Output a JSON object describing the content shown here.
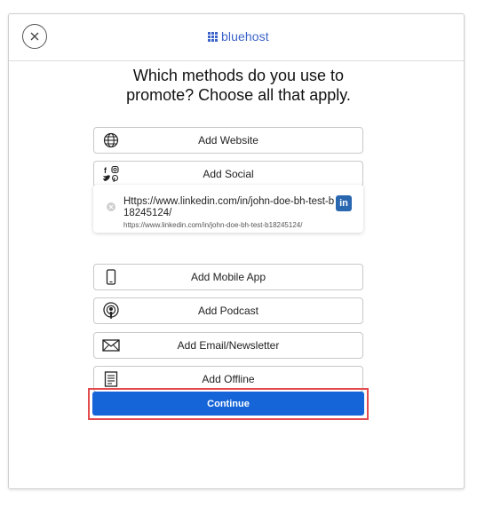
{
  "brand": {
    "logo_text": "bluehost",
    "color": "#3b63c9"
  },
  "title_line1": "Which methods do you use to",
  "title_line2": "promote? Choose all that apply.",
  "options": [
    {
      "label": "Add Website",
      "icon": "globe-icon"
    },
    {
      "label": "Add Social",
      "icon": "social-icons"
    },
    {
      "label": "Add Mobile App",
      "icon": "phone-icon"
    },
    {
      "label": "Add Podcast",
      "icon": "podcast-icon"
    },
    {
      "label": "Add Email/Newsletter",
      "icon": "envelope-icon"
    },
    {
      "label": "Add Offline",
      "icon": "document-icon"
    }
  ],
  "social_entry": {
    "url": "Https://www.linkedin.com/in/john-doe-bh-test-b18245124/",
    "sub": "https://www.linkedin.com/in/john-doe-bh-test-b18245124/",
    "network_icon": "linkedin-icon",
    "badge_text": "in"
  },
  "continue_label": "Continue",
  "colors": {
    "primary": "#1565d8",
    "highlight": "#e34b4f",
    "linkedin": "#2a67b1"
  }
}
